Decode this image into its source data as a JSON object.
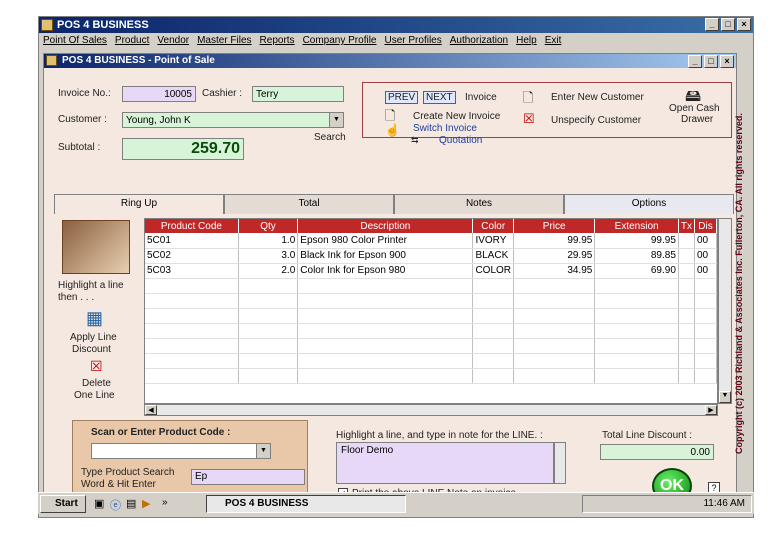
{
  "app": {
    "title": "POS 4 BUSINESS",
    "window_buttons": [
      "_",
      "□",
      "×"
    ]
  },
  "menu": [
    "Point Of Sales",
    "Product",
    "Vendor",
    "Master Files",
    "Reports",
    "Company Profile",
    "User Profiles",
    "Authorization",
    "Help",
    "Exit"
  ],
  "window": {
    "title": "POS 4 BUSINESS - Point of Sale",
    "buttons": [
      "_",
      "□",
      "×"
    ]
  },
  "form": {
    "invoice_label": "Invoice No.:",
    "invoice_value": "10005",
    "cashier_label": "Cashier :",
    "cashier_value": "Terry",
    "customer_label": "Customer :",
    "customer_value": "Young, John K",
    "search_label": "Search",
    "subtotal_label": "Subtotal :",
    "subtotal_value": "259.70"
  },
  "actions": {
    "prev": "PREV",
    "next": "NEXT",
    "invoice": "Invoice",
    "create_invoice": "Create New Invoice",
    "switch_invoice": "Switch Invoice",
    "quotation": "Quotation",
    "enter_customer": "Enter New Customer",
    "unspecify_customer": "Unspecify Customer",
    "open_drawer_1": "Open Cash",
    "open_drawer_2": "Drawer"
  },
  "tabs": [
    "Ring Up",
    "Total",
    "Notes",
    "Options"
  ],
  "left_panel": {
    "highlight_1": "Highlight a line",
    "highlight_2": "then . . .",
    "apply_1": "Apply Line",
    "apply_2": "Discount",
    "delete_1": "Delete",
    "delete_2": "One Line"
  },
  "grid": {
    "headers": [
      "Product Code",
      "Qty",
      "Description",
      "Color",
      "Price",
      "Extension",
      "Tx",
      "Dis"
    ],
    "rows": [
      [
        "5C01",
        "1.0",
        "Epson 980 Color Printer",
        "IVORY",
        "99.95",
        "99.95",
        "",
        "00"
      ],
      [
        "5C02",
        "3.0",
        "Black Ink for Epson 900",
        "BLACK",
        "29.95",
        "89.85",
        "",
        "00"
      ],
      [
        "5C03",
        "2.0",
        "Color Ink for Epson 980",
        "COLOR",
        "34.95",
        "69.90",
        "",
        "00"
      ]
    ]
  },
  "scan": {
    "label": "Scan or Enter Product Code :",
    "search_label_1": "Type Product Search",
    "search_label_2": "Word & Hit Enter",
    "search_value": "Ep"
  },
  "note": {
    "label": "Highlight a line, and type in note for the LINE. :",
    "value": "Floor Demo",
    "checkbox_label": "Print the above LINE Note on invoice",
    "checkbox_mark": "✓"
  },
  "discount": {
    "label": "Total Line Discount :",
    "value": "0.00"
  },
  "ok_label": "OK",
  "help_label": "?",
  "copyright": "Copyright (c) 2003 Richland & Associates Inc. Fullerton, CA. All rights reserved.",
  "taskbar": {
    "start": "Start",
    "chevrons": "»",
    "task": "POS 4 BUSINESS",
    "time": "11:46 AM"
  }
}
